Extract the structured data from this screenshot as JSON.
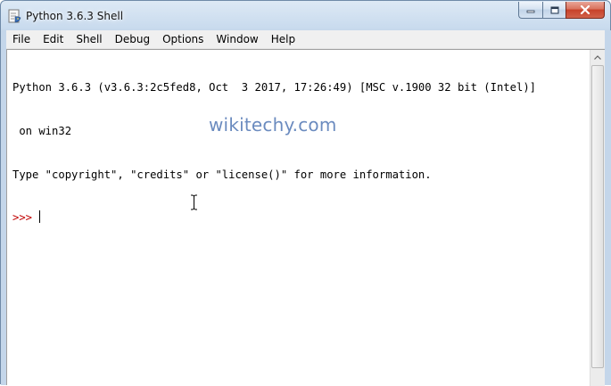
{
  "window": {
    "title": "Python 3.6.3 Shell",
    "controls": {
      "minimize": "minimize",
      "maximize": "maximize",
      "close": "close"
    }
  },
  "menubar": {
    "items": [
      "File",
      "Edit",
      "Shell",
      "Debug",
      "Options",
      "Window",
      "Help"
    ]
  },
  "shell": {
    "lines": [
      "Python 3.6.3 (v3.6.3:2c5fed8, Oct  3 2017, 17:26:49) [MSC v.1900 32 bit (Intel)]",
      " on win32",
      "Type \"copyright\", \"credits\" or \"license()\" for more information."
    ],
    "prompt": ">>> "
  },
  "watermark": "wikitechy.com",
  "colors": {
    "prompt": "#c00000",
    "watermark": "#6b8bbf",
    "close_button": "#c7412a"
  },
  "icons": {
    "app": "python-idle-icon",
    "minimize": "minimize-icon",
    "maximize": "maximize-icon",
    "close": "close-icon",
    "cursor": "ibeam-cursor-icon",
    "scroll_up": "scroll-up-arrow-icon"
  }
}
